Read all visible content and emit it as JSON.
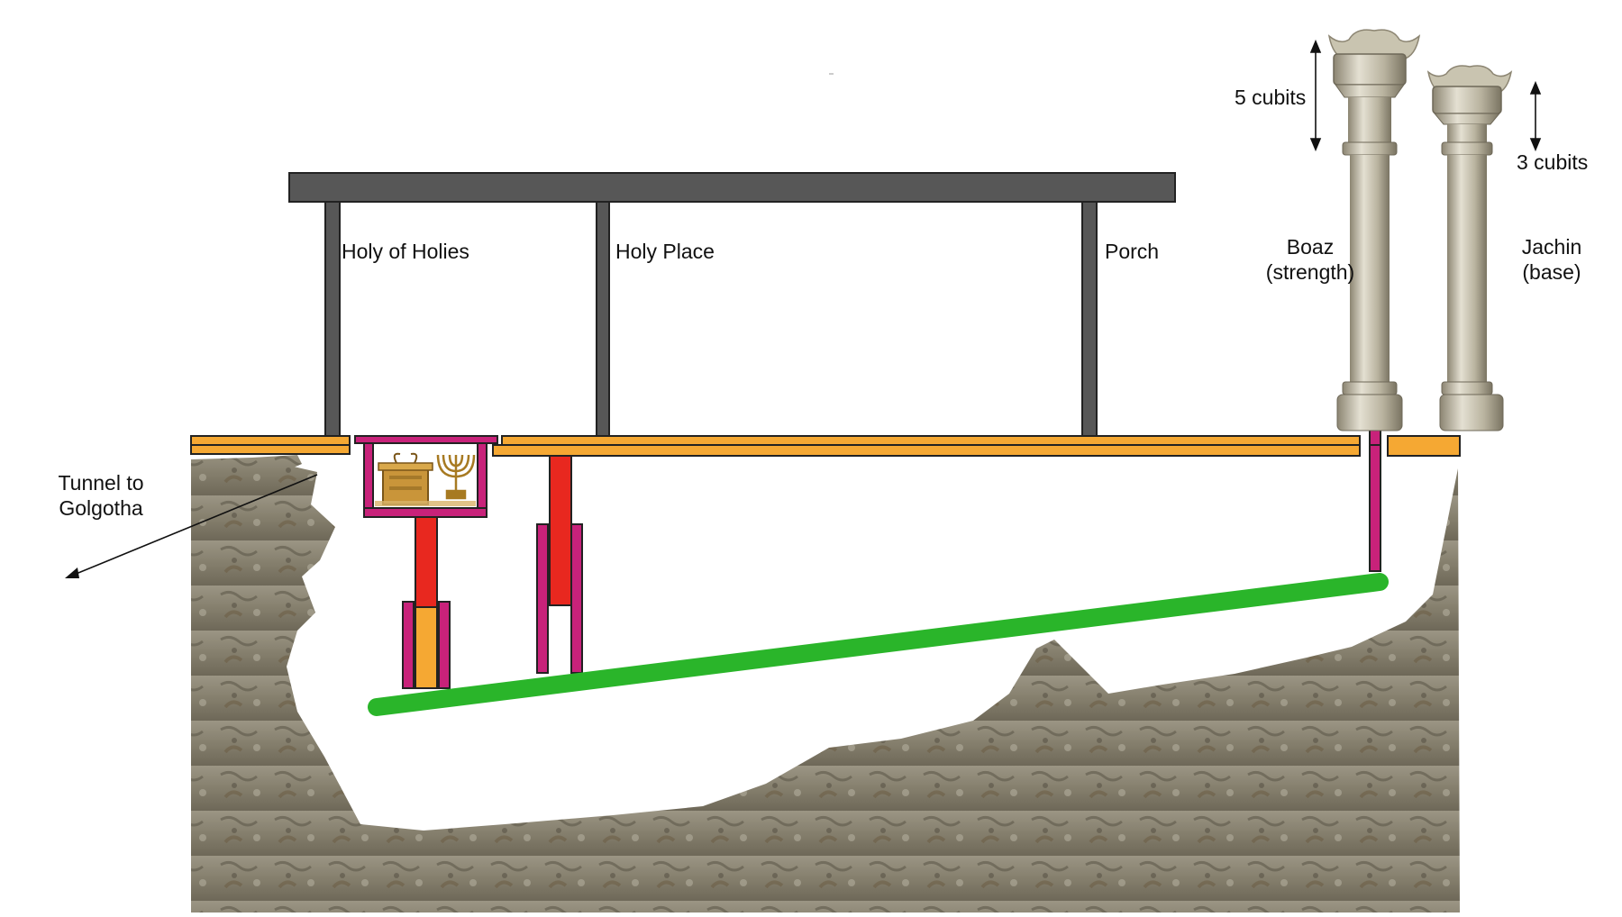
{
  "labels": {
    "holy_of_holies": "Holy of Holies",
    "holy_place": "Holy Place",
    "porch": "Porch",
    "boaz_name": "Boaz",
    "boaz_meaning": "(strength)",
    "jachin_name": "Jachin",
    "jachin_meaning": "(base)",
    "boaz_capital_height": "5 cubits",
    "jachin_capital_height": "3 cubits",
    "tunnel_line1": "Tunnel to",
    "tunnel_line2": "Golgotha"
  },
  "colors": {
    "roof": "#575757",
    "floor": "#f5a833",
    "magenta": "#c8227a",
    "red": "#e8281f",
    "green": "#2ab52a",
    "rock": "#8a8474",
    "pillar": "#c9c4b0"
  }
}
